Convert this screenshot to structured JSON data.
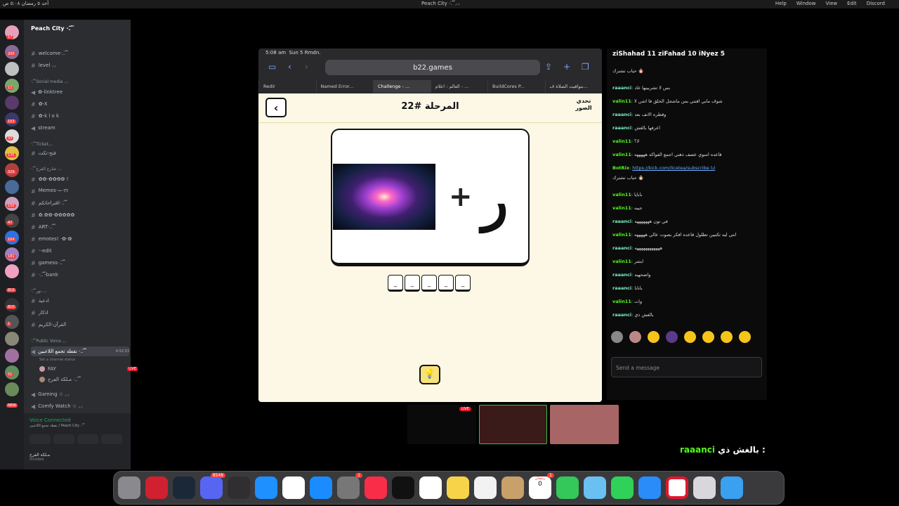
{
  "menubar": {
    "left": "أحد ٥ رمضان ٥:٠٨ ص",
    "center": "Peach City ·. ፝֟ ⸝⸝",
    "items": [
      "Help",
      "Window",
      "View",
      "Edit",
      "Discord"
    ]
  },
  "discord": {
    "server_name": "Peach City ·. ፝֟",
    "rail_badges": [
      "17",
      "200",
      "12",
      "153",
      "33",
      "135",
      "329",
      "150",
      "47",
      "164",
      "181",
      "810",
      "810",
      "1",
      "51",
      "NEW"
    ],
    "channels": [
      {
        "label": "welcome·.. ፝֟",
        "type": "text"
      },
      {
        "label": "level ⸝⸝",
        "type": "text"
      },
      {
        "label": "·. ፝֟ Social media ⸝⸝",
        "type": "category"
      },
      {
        "label": "✿-linktree",
        "type": "text"
      },
      {
        "label": "✿-X",
        "type": "text"
      },
      {
        "label": "✿-k l o k",
        "type": "text"
      },
      {
        "label": "stream",
        "type": "voice"
      },
      {
        "label": "·. ፝֟ Ticket⸝⸝",
        "type": "category"
      },
      {
        "label": "فتح-تكت",
        "type": "text"
      },
      {
        "label": "·. ፝֟ شارع الفرح ⸝⸝",
        "type": "category"
      },
      {
        "label": "✿✿-✿✿✿✿ !",
        "type": "text"
      },
      {
        "label": "Memes·ꕀ·ᰔ",
        "type": "text"
      },
      {
        "label": "اقتراحاتكم·.. ፝֟",
        "type": "text"
      },
      {
        "label": "✿.✿✿-✿✿✿✿✿",
        "type": "text"
      },
      {
        "label": "ART·.. ፝֟",
        "type": "text"
      },
      {
        "label": "emotes! ·✿-✿",
        "type": "text"
      },
      {
        "label": "ᵕ-edit",
        "type": "text"
      },
      {
        "label": "gamess·.. ፝֟",
        "type": "text"
      },
      {
        "label": "·.. ፝֟-bank",
        "type": "text"
      },
      {
        "label": "·. ፝֟ نور ⸝⸝",
        "type": "category"
      },
      {
        "label": "ادعية",
        "type": "text"
      },
      {
        "label": "اذكار",
        "type": "text"
      },
      {
        "label": "القرآن-الكريم",
        "type": "text"
      },
      {
        "label": "·. ፝֟ Public Voice ⸝⸝",
        "type": "category"
      },
      {
        "label": "نقطة تجمع اللاعبين ·.. ፝֟",
        "type": "voice-active"
      },
      {
        "label": "Set a channel status",
        "type": "status"
      },
      {
        "label": "FAY",
        "type": "member"
      },
      {
        "label": "مـلكة الفرح ·.. ፝֟",
        "type": "member"
      },
      {
        "label": "Gaming ☆ ⸝⸝",
        "type": "voice"
      },
      {
        "label": "Comfy Watch ☆ ⸝⸝",
        "type": "voice"
      }
    ],
    "voice_timer": "4:52:53",
    "live_badge": "LIVE",
    "voice_connected": "Voice Connected",
    "voice_sub": "نقطة تجمع اللاعبين / Peach City ·. ፝֟",
    "username": "مـلكة الفرح",
    "user_status": "Invisible"
  },
  "browser": {
    "time": "5:08 am",
    "date": "Sun 5 Rmdn.",
    "url": "b22.games",
    "tabs": [
      "Redir",
      "Named Error...",
      "Challenge - ...",
      "العالم : اعلام - ...",
      "BuildCores P...",
      "مواقيت الصلاة ف..."
    ]
  },
  "game": {
    "level_title": "المرحلة #22",
    "logo": "تحدي الصور",
    "back_icon": "chevron-left-icon",
    "plus": "+",
    "letter": "ر",
    "answer_slots": [
      "_",
      "_",
      "_",
      "_",
      "_"
    ],
    "hint_icon": "lightbulb-icon"
  },
  "chat": {
    "top": "ziShahad 11 ziFahad 10 iNyez 5",
    "messages": [
      {
        "user": "",
        "text": "حباب تشترك 🪆"
      },
      {
        "user": "raaanci",
        "text": "بس لا تشربينها عاد"
      },
      {
        "user": "valin11",
        "text": "شوف مابي افتني بس ماشجل الحلق فا اشن لا"
      },
      {
        "user": "raaanci",
        "text": "وقطره الانف بعد"
      },
      {
        "user": "raaanci",
        "text": "اعرفها بالغش"
      },
      {
        "user": "valin11",
        "text": "لا؟"
      },
      {
        "user": "valin11",
        "text": "قاعده اسوي عصف ذهني اجمع الفواكه هههههه"
      },
      {
        "user": "BotRix",
        "text": "https://kick.com/licetea/subscribe اذا"
      },
      {
        "user": "",
        "text": "حباب تشترك 🪆"
      },
      {
        "user": "valin11",
        "text": "بابايا"
      },
      {
        "user": "valin11",
        "text": "جيبه"
      },
      {
        "user": "raaanci",
        "text": "في تون هههههههه"
      },
      {
        "user": "valin11",
        "text": "انتي ليه تكتبين تطلول قاعده افكر بصوت عالي هههههه"
      },
      {
        "user": "raaanci",
        "text": "ههههههههههههه"
      },
      {
        "user": "valin11",
        "text": "ابشر"
      },
      {
        "user": "raaanci",
        "text": "واضحهيه"
      },
      {
        "user": "raaanci",
        "text": "بانانا"
      },
      {
        "user": "valin11",
        "text": "وات"
      },
      {
        "user": "raaanci",
        "text": "بالغش ذي"
      }
    ],
    "send_placeholder": "Send a message"
  },
  "stream": {
    "live": "LIVE",
    "overlay_user": "raaanci",
    "overlay_text": "بالغش ذي :"
  },
  "dock": {
    "apps": [
      "trash",
      "opera-gx",
      "steam",
      "discord",
      "obs",
      "safari",
      "photos",
      "app-store",
      "system-settings",
      "music",
      "tv",
      "freeform",
      "notes",
      "reminders",
      "contacts",
      "calendar",
      "facetime",
      "maps",
      "messages",
      "mail",
      "opera",
      "launchpad",
      "finder"
    ],
    "badges": {
      "discord": "8548",
      "system-settings": "1",
      "calendar": "1"
    },
    "calendar_day": "0",
    "calendar_month": "رمضان"
  }
}
